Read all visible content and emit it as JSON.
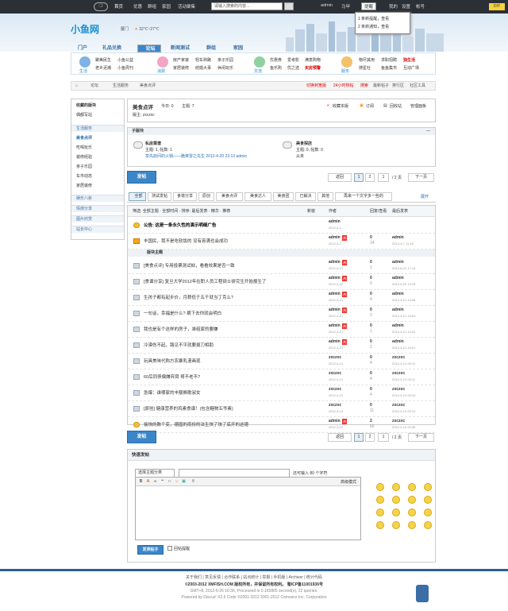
{
  "topbar": {
    "nav": [
      "首页",
      "优惠",
      "群组",
      "家园",
      "活动聚集"
    ],
    "search_placeholder": "请输入搜索的内容...",
    "user": "admin",
    "menu": [
      "马甲",
      "提醒",
      "我的",
      "设置",
      "帐号"
    ],
    "diy": "DIY"
  },
  "notify": [
    "1 条新提醒，查看",
    "2 条新通知，查看"
  ],
  "header": {
    "brand": "小鱼网",
    "city": "厦门",
    "weather": "32℃~27℃"
  },
  "nav": [
    "门户",
    "礼品兑换",
    "论坛",
    "新闻测试",
    "群组",
    "家园"
  ],
  "menu": {
    "c1": {
      "label": "生活",
      "links": [
        "聚美民生",
        "小鱼公益",
        "老乡泥潮",
        "小鱼周刊"
      ]
    },
    "c2": {
      "label": "消费",
      "links": [
        "房产家装",
        "轻车熟路",
        "亲子乐园",
        "家居装修",
        "结婚大事",
        "休闲玩乐"
      ]
    },
    "c3": {
      "label": "交流",
      "links": [
        "优惠券",
        "爱考影",
        "满意购物",
        "鱼乐购",
        "优之选",
        "买房预警"
      ]
    },
    "c4": {
      "label": "服务",
      "links": [
        "物尽其用",
        "求职招聘",
        "独生活",
        "搜星社",
        "鱼鱼集市",
        "互动广场"
      ]
    }
  },
  "crumb": {
    "items": [
      "论坛",
      "生活服务",
      "美食点评"
    ],
    "r1": "切换到宽版",
    "r2": "24小时热帖",
    "r3": "搜索",
    "r4": "最新帖子",
    "r5": "排行区",
    "r6": "社区工具"
  },
  "sidebar": {
    "fav": "收藏的版块",
    "fav_item": "偶都写站",
    "s1": "生活服务",
    "s1_items": [
      "美食点评",
      "吃喝玩乐",
      "装修经验",
      "亲子乐园",
      "车市动态",
      "家居装修"
    ],
    "s2": "娱乐八卦",
    "s3": "情感分享",
    "s4": "图片欣赏",
    "s5": "站长中心"
  },
  "forum": {
    "title": "美食点评",
    "today": "今日: 0",
    "topics": "主题: 7",
    "mod": "版主: zxczxc",
    "fav": "收藏本版",
    "rss": "订阅",
    "mine": "回收站",
    "admin": "管理面板"
  },
  "subforums": {
    "header": "子版块",
    "a_name": "私房菜谱",
    "a_stats": "主题: 1, 帖数: 1",
    "a_last": "享先启问的火锅——脆爽冒之先生 2012-4-20 23:13 admin",
    "b_name": "美食探店",
    "b_stats": "主题: 0, 帖数: 0",
    "b_last": "从未"
  },
  "post_btn": "发帖",
  "pager": {
    "prev": "返回",
    "p1": "1",
    "p2": "2",
    "page": "1",
    "total": "/ 2 页",
    "next": "下一页"
  },
  "tabs": [
    "全部",
    "测试发帖",
    "食谱分享",
    "原创",
    "美食点评",
    "美食达人",
    "美食团",
    "已解决",
    "其他",
    "再来一个文字多一些的"
  ],
  "tabs_more": "展开",
  "listhead": {
    "filter": "筛选: 全部主题 · 全部时间 · 排序: 最后发表 · 精华 · 推荐",
    "newwin": "新窗",
    "author": "作者",
    "replies": "回复/查看",
    "last": "最后发表"
  },
  "sticky_sep": "版块主题",
  "rows": [
    {
      "title": "公告: 这是一条永久性的演示明细广告",
      "author": "admin",
      "date": "2012-4-2",
      "replies": "",
      "views": "",
      "last": "",
      "last_date": "",
      "kind": "ann",
      "hot": false
    },
    {
      "title": "丰国民，我不是吃软饭的 没有容满也会成功",
      "author": "admin",
      "date": "2012-4-7",
      "replies": "0",
      "views": "14",
      "last": "admin",
      "last_date": "2012-4-7 11:15",
      "kind": "top",
      "hot": true
    },
    {
      "title": "[美食点评] 专用投票测试帖，看看效果是否一致",
      "author": "admin",
      "date": "2012-6-21",
      "replies": "0",
      "views": "1",
      "last": "admin",
      "last_date": "2012-6-21 17:14",
      "kind": "n",
      "hot": true
    },
    {
      "title": "[食谱分享] 复旦大学2012年在职人员工程硕士研究生开始报生了",
      "author": "admin",
      "date": "2012-4-22",
      "replies": "0",
      "views": "0",
      "last": "admin",
      "last_date": "2012-4-22 14:25",
      "kind": "n",
      "hot": true
    },
    {
      "title": "生孩子都有起步价，月薪低于五千就当丁克么?",
      "author": "admin",
      "date": "2012-4-21",
      "replies": "0",
      "views": "4",
      "last": "admin",
      "last_date": "2012-4-21 14:08",
      "kind": "n",
      "hot": true
    },
    {
      "title": "一句话，幸福是什么? 摘下去你就会明白",
      "author": "admin",
      "date": "2012-4-21",
      "replies": "0",
      "views": "2",
      "last": "admin",
      "last_date": "2012-4-21 14:03",
      "kind": "n",
      "hot": true
    },
    {
      "title": "我也是有个这样的房子，准组家的要嫌",
      "author": "admin",
      "date": "2012-4-21",
      "replies": "0",
      "views": "1",
      "last": "admin",
      "last_date": "2012-4-21 14:02",
      "kind": "n",
      "hot": true
    },
    {
      "title": "冷漠伤不起，路见不平就要拔刀相助",
      "author": "admin",
      "date": "2012-4-21",
      "replies": "0",
      "views": "2",
      "last": "admin",
      "last_date": "2012-4-21 14:01",
      "kind": "n",
      "hot": true
    },
    {
      "title": "玩具美味代购方农暴乳漫画现",
      "author": "zxczxc",
      "date": "2012-4-21",
      "replies": "0",
      "views": "4",
      "last": "zxczxc",
      "last_date": "2012-4-21 00:12",
      "kind": "n",
      "hot": false
    },
    {
      "title": "60后同债偏嫌弃窝 哥不老不?",
      "author": "zxczxc",
      "date": "2012-4-21",
      "replies": "0",
      "views": "4",
      "last": "zxczxc",
      "last_date": "2012-4-21 00:11",
      "kind": "n",
      "hot": false
    },
    {
      "title": "急爆：谁哪家的丰额撕歌淑女",
      "author": "zxczxc",
      "date": "2012-4-21",
      "replies": "0",
      "views": "4",
      "last": "zxczxc",
      "last_date": "2012-4-21 00:10",
      "kind": "n",
      "hot": false
    },
    {
      "title": "[原创] 健康营养的鸡素食谱！(包含糖物五爷素)",
      "author": "zxczxc",
      "date": "2012-4-14",
      "replies": "0",
      "views": "11",
      "last": "zxczxc",
      "last_date": "2012-4-14 22:13",
      "kind": "n",
      "hot": false
    },
    {
      "title": "偷快的数个变，德国的雨份的法生快了快了底开的这德",
      "author": "admin",
      "date": "2012-3-27",
      "replies": "2",
      "views": "66",
      "last": "zxczxc",
      "last_date": "2012-4-14 22:06",
      "kind": "ann",
      "hot": true
    }
  ],
  "quickpost": {
    "title": "快速发帖",
    "cat": "选择主题分类",
    "hint": "还可输入 80 个字符",
    "adv": "高级模式",
    "submit": "发表帖子",
    "notify": "回帖提醒"
  },
  "footer": {
    "links": "关于我们 | 意见反馈 | 合作联系 | 站点统计 | 举报 | 手机版 | Archiver | 统计代码",
    "copy": "©2003-2012 XMFISH.COM 版权所有，并保留所有权利。 蜀ICP备11001936号",
    "gmt": "GMT+8, 2012-6-26 16:36, Processed in 0.165805 second(s), 22 queries.",
    "powered": "Powered by Discuz! X2.5 Code ©2001-2012 2001-2012 Comsenz Inc. Corporation"
  }
}
